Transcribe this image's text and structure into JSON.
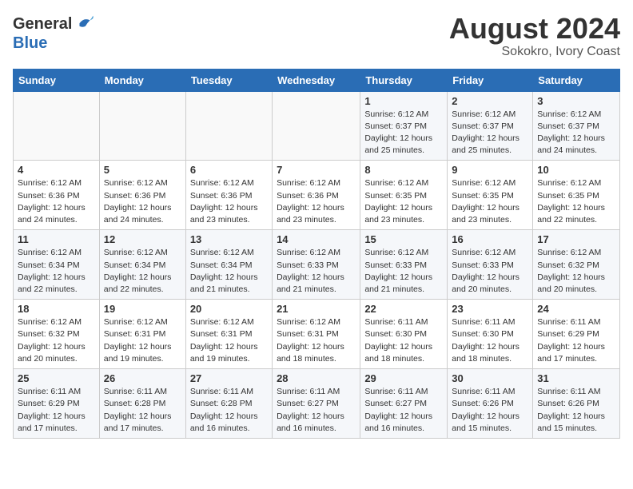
{
  "header": {
    "logo_line1": "General",
    "logo_line2": "Blue",
    "month_year": "August 2024",
    "location": "Sokokro, Ivory Coast"
  },
  "weekdays": [
    "Sunday",
    "Monday",
    "Tuesday",
    "Wednesday",
    "Thursday",
    "Friday",
    "Saturday"
  ],
  "weeks": [
    [
      {
        "day": "",
        "detail": ""
      },
      {
        "day": "",
        "detail": ""
      },
      {
        "day": "",
        "detail": ""
      },
      {
        "day": "",
        "detail": ""
      },
      {
        "day": "1",
        "detail": "Sunrise: 6:12 AM\nSunset: 6:37 PM\nDaylight: 12 hours\nand 25 minutes."
      },
      {
        "day": "2",
        "detail": "Sunrise: 6:12 AM\nSunset: 6:37 PM\nDaylight: 12 hours\nand 25 minutes."
      },
      {
        "day": "3",
        "detail": "Sunrise: 6:12 AM\nSunset: 6:37 PM\nDaylight: 12 hours\nand 24 minutes."
      }
    ],
    [
      {
        "day": "4",
        "detail": "Sunrise: 6:12 AM\nSunset: 6:36 PM\nDaylight: 12 hours\nand 24 minutes."
      },
      {
        "day": "5",
        "detail": "Sunrise: 6:12 AM\nSunset: 6:36 PM\nDaylight: 12 hours\nand 24 minutes."
      },
      {
        "day": "6",
        "detail": "Sunrise: 6:12 AM\nSunset: 6:36 PM\nDaylight: 12 hours\nand 23 minutes."
      },
      {
        "day": "7",
        "detail": "Sunrise: 6:12 AM\nSunset: 6:36 PM\nDaylight: 12 hours\nand 23 minutes."
      },
      {
        "day": "8",
        "detail": "Sunrise: 6:12 AM\nSunset: 6:35 PM\nDaylight: 12 hours\nand 23 minutes."
      },
      {
        "day": "9",
        "detail": "Sunrise: 6:12 AM\nSunset: 6:35 PM\nDaylight: 12 hours\nand 23 minutes."
      },
      {
        "day": "10",
        "detail": "Sunrise: 6:12 AM\nSunset: 6:35 PM\nDaylight: 12 hours\nand 22 minutes."
      }
    ],
    [
      {
        "day": "11",
        "detail": "Sunrise: 6:12 AM\nSunset: 6:34 PM\nDaylight: 12 hours\nand 22 minutes."
      },
      {
        "day": "12",
        "detail": "Sunrise: 6:12 AM\nSunset: 6:34 PM\nDaylight: 12 hours\nand 22 minutes."
      },
      {
        "day": "13",
        "detail": "Sunrise: 6:12 AM\nSunset: 6:34 PM\nDaylight: 12 hours\nand 21 minutes."
      },
      {
        "day": "14",
        "detail": "Sunrise: 6:12 AM\nSunset: 6:33 PM\nDaylight: 12 hours\nand 21 minutes."
      },
      {
        "day": "15",
        "detail": "Sunrise: 6:12 AM\nSunset: 6:33 PM\nDaylight: 12 hours\nand 21 minutes."
      },
      {
        "day": "16",
        "detail": "Sunrise: 6:12 AM\nSunset: 6:33 PM\nDaylight: 12 hours\nand 20 minutes."
      },
      {
        "day": "17",
        "detail": "Sunrise: 6:12 AM\nSunset: 6:32 PM\nDaylight: 12 hours\nand 20 minutes."
      }
    ],
    [
      {
        "day": "18",
        "detail": "Sunrise: 6:12 AM\nSunset: 6:32 PM\nDaylight: 12 hours\nand 20 minutes."
      },
      {
        "day": "19",
        "detail": "Sunrise: 6:12 AM\nSunset: 6:31 PM\nDaylight: 12 hours\nand 19 minutes."
      },
      {
        "day": "20",
        "detail": "Sunrise: 6:12 AM\nSunset: 6:31 PM\nDaylight: 12 hours\nand 19 minutes."
      },
      {
        "day": "21",
        "detail": "Sunrise: 6:12 AM\nSunset: 6:31 PM\nDaylight: 12 hours\nand 18 minutes."
      },
      {
        "day": "22",
        "detail": "Sunrise: 6:11 AM\nSunset: 6:30 PM\nDaylight: 12 hours\nand 18 minutes."
      },
      {
        "day": "23",
        "detail": "Sunrise: 6:11 AM\nSunset: 6:30 PM\nDaylight: 12 hours\nand 18 minutes."
      },
      {
        "day": "24",
        "detail": "Sunrise: 6:11 AM\nSunset: 6:29 PM\nDaylight: 12 hours\nand 17 minutes."
      }
    ],
    [
      {
        "day": "25",
        "detail": "Sunrise: 6:11 AM\nSunset: 6:29 PM\nDaylight: 12 hours\nand 17 minutes."
      },
      {
        "day": "26",
        "detail": "Sunrise: 6:11 AM\nSunset: 6:28 PM\nDaylight: 12 hours\nand 17 minutes."
      },
      {
        "day": "27",
        "detail": "Sunrise: 6:11 AM\nSunset: 6:28 PM\nDaylight: 12 hours\nand 16 minutes."
      },
      {
        "day": "28",
        "detail": "Sunrise: 6:11 AM\nSunset: 6:27 PM\nDaylight: 12 hours\nand 16 minutes."
      },
      {
        "day": "29",
        "detail": "Sunrise: 6:11 AM\nSunset: 6:27 PM\nDaylight: 12 hours\nand 16 minutes."
      },
      {
        "day": "30",
        "detail": "Sunrise: 6:11 AM\nSunset: 6:26 PM\nDaylight: 12 hours\nand 15 minutes."
      },
      {
        "day": "31",
        "detail": "Sunrise: 6:11 AM\nSunset: 6:26 PM\nDaylight: 12 hours\nand 15 minutes."
      }
    ]
  ]
}
